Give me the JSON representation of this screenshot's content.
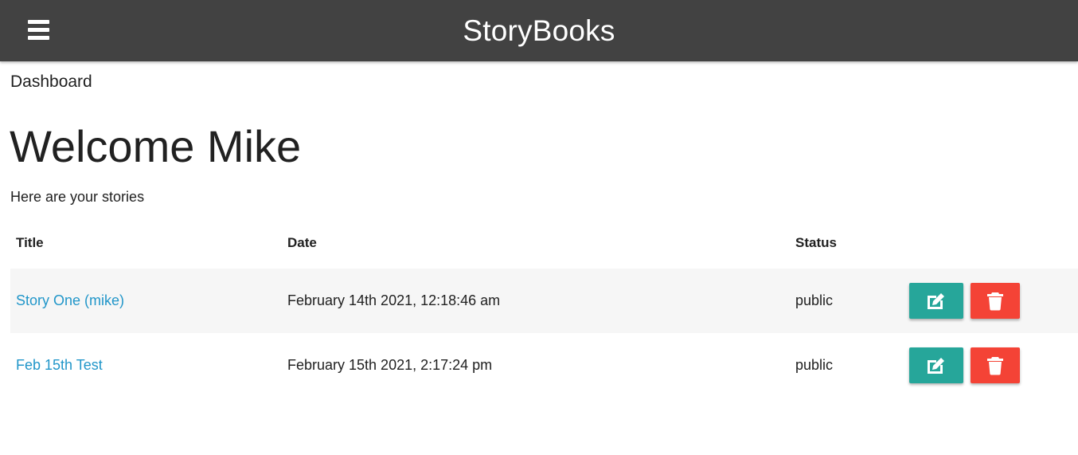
{
  "navbar": {
    "brand": "StoryBooks",
    "menu_icon": "hamburger-menu-icon"
  },
  "breadcrumb": "Dashboard",
  "welcome_heading": "Welcome Mike",
  "subtitle": "Here are your stories",
  "table": {
    "headers": [
      "Title",
      "Date",
      "Status",
      ""
    ],
    "rows": [
      {
        "title": "Story One (mike)",
        "date": "February 14th 2021, 12:18:46 am",
        "status": "public",
        "edit_icon": "edit-icon",
        "delete_icon": "trash-icon"
      },
      {
        "title": "Feb 15th Test",
        "date": "February 15th 2021, 2:17:24 pm",
        "status": "public",
        "edit_icon": "edit-icon",
        "delete_icon": "trash-icon"
      }
    ]
  },
  "colors": {
    "navbar": "#424242",
    "link": "#2196c9",
    "edit_button": "#26a69a",
    "delete_button": "#f44336",
    "striped_row": "#f6f6f6"
  }
}
